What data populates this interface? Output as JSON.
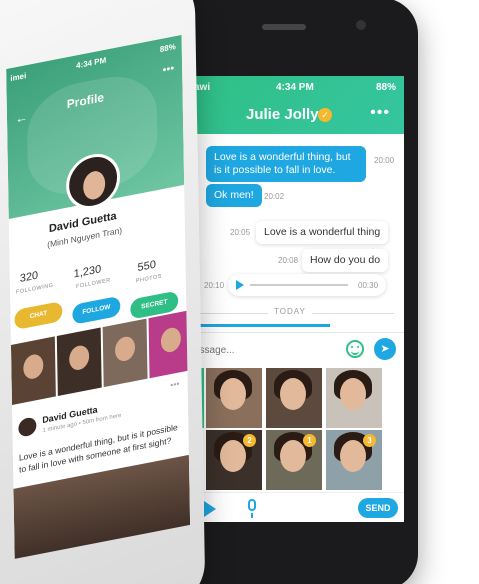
{
  "chat": {
    "status_left": "awi",
    "time": "4:34 PM",
    "battery": "88%",
    "title": "Julie Jolly",
    "verified_icon": "check",
    "messages": [
      {
        "text": "Love is a wonderful thing, but is it possible to fall in love.",
        "time": "20:00",
        "side": "in"
      },
      {
        "text": "Ok men!",
        "time": "20:02",
        "side": "in"
      },
      {
        "text": "Love is a wonderful thing",
        "time": "20:05",
        "side": "out"
      },
      {
        "text": "How do you do",
        "time": "20:08",
        "side": "out"
      }
    ],
    "audio": {
      "start": "20:10",
      "end": "00:30"
    },
    "divider": "TODAY",
    "input_placeholder": "essage...",
    "grid_badges": [
      "2",
      "1",
      "3"
    ],
    "send_label": "SEND"
  },
  "profile": {
    "status_left": "imei",
    "time": "4:34 PM",
    "battery": "88%",
    "title": "Profile",
    "name": "David Guetta",
    "subname": "(Minh Nguyen Tran)",
    "stats": [
      {
        "value": "320",
        "label": "FOLLOWING"
      },
      {
        "value": "1,230",
        "label": "FOLLOWER"
      },
      {
        "value": "550",
        "label": "PHOTOS"
      }
    ],
    "buttons": [
      {
        "label": "CHAT",
        "color": "#e8b830"
      },
      {
        "label": "FOLLOW",
        "color": "#1ea7e1"
      },
      {
        "label": "SECRET",
        "color": "#2fbf86"
      }
    ],
    "post": {
      "author": "David Guetta",
      "meta": "1 minute ago • 50m from here",
      "text": "Love is a wonderful thing, but is it possible to fall in love with someone at first sight?"
    }
  }
}
